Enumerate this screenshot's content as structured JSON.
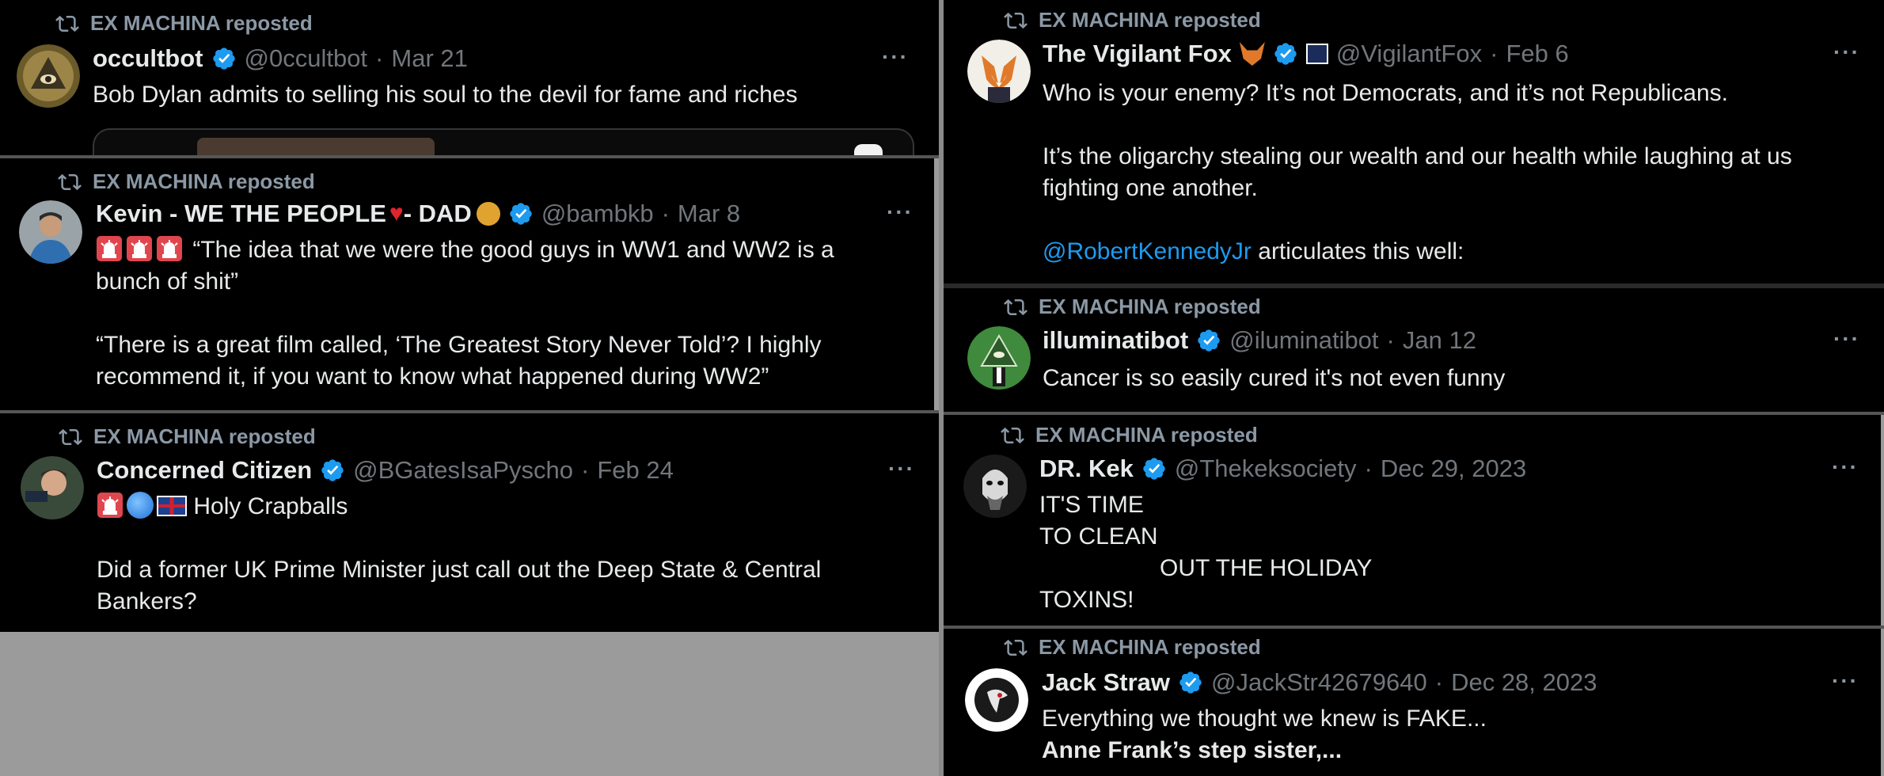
{
  "repost_label": "EX MACHINA reposted",
  "colors": {
    "background": "#000000",
    "text": "#e7e9ea",
    "muted": "#71767b",
    "link": "#1d9bf0",
    "verified": "#1d9bf0",
    "panel_gap": "#9b9b9b"
  },
  "tweets": [
    {
      "name": "occultbot",
      "handle": "@0ccultbot",
      "date": "Mar 21",
      "text": "Bob Dylan admits to selling his soul to the devil for fame and riches"
    },
    {
      "name": "Kevin - WE THE PEOPLE",
      "name_mid": " - DAD",
      "handle": "@bambkb",
      "date": "Mar 8",
      "text_1": "“The idea that we were the good guys in WW1 and WW2 is a bunch of shit”",
      "text_2": "“There is a great film called, ‘The Greatest Story Never Told’? I highly recommend it, if you want to know what happened during WW2”"
    },
    {
      "name": "Concerned Citizen",
      "handle": "@BGatesIsaPyscho",
      "date": "Feb 24",
      "text_1": "Holy Crapballs",
      "text_2": "Did a former UK Prime Minister just call out the Deep State & Central Bankers?"
    },
    {
      "name": "The Vigilant Fox",
      "handle": "@VigilantFox",
      "date": "Feb 6",
      "text_1": "Who is your enemy? It’s not Democrats, and it’s not Republicans.",
      "text_2": "It’s the oligarchy stealing our wealth and our health while laughing at us fighting one another.",
      "mention": "@RobertKennedyJr",
      "text_3": " articulates this well:"
    },
    {
      "name": "illuminatibot",
      "handle": "@iluminatibot",
      "date": "Jan 12",
      "text": "Cancer is so easily cured it's not even funny"
    },
    {
      "name": "DR. Kek",
      "handle": "@Thekeksociety",
      "date": "Dec 29, 2023",
      "lines": [
        "IT'S TIME",
        "TO CLEAN",
        "OUT THE HOLIDAY",
        "TOXINS!"
      ]
    },
    {
      "name": "Jack Straw",
      "handle": "@JackStr42679640",
      "date": "Dec 28, 2023",
      "text_1": "Everything we thought we knew is FAKE...",
      "text_2": "Anne Frank’s step sister,..."
    }
  ],
  "more_label": "···",
  "dot": "·"
}
